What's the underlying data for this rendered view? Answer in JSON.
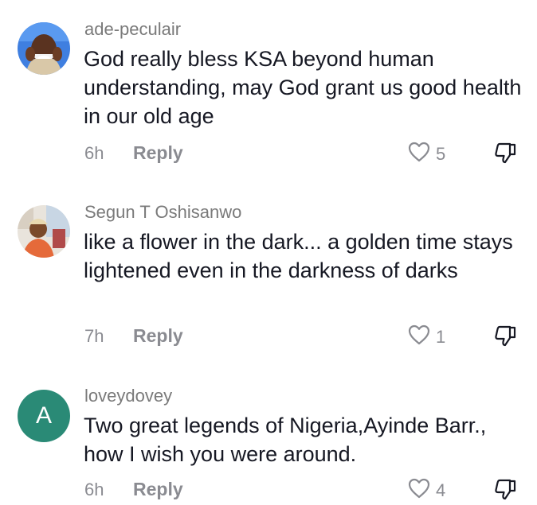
{
  "comments": [
    {
      "username": "ade-peculair",
      "text": "God really bless KSA beyond human understanding, may God grant us good health in our old age",
      "time": "6h",
      "reply_label": "Reply",
      "likes": "5",
      "avatar_icon": "user-photo-avatar"
    },
    {
      "username": "Segun T Oshisanwo",
      "text": "like a flower in the dark... a golden time stays lightened even in the darkness of darks",
      "time": "7h",
      "reply_label": "Reply",
      "likes": "1",
      "avatar_icon": "user-photo-avatar"
    },
    {
      "username": "loveydovey",
      "text": "Two great legends of Nigeria,Ayinde Barr., how I wish you were around.",
      "time": "6h",
      "reply_label": "Reply",
      "likes": "4",
      "avatar_letter": "A",
      "avatar_color": "#2a8a76"
    }
  ],
  "icons": {
    "like": "heart-outline-icon",
    "dislike": "thumbs-down-icon"
  },
  "colors": {
    "text": "#161823",
    "secondary": "#8a8b91",
    "username": "#7a7a7a",
    "letter_avatar": "#2a8a76"
  }
}
